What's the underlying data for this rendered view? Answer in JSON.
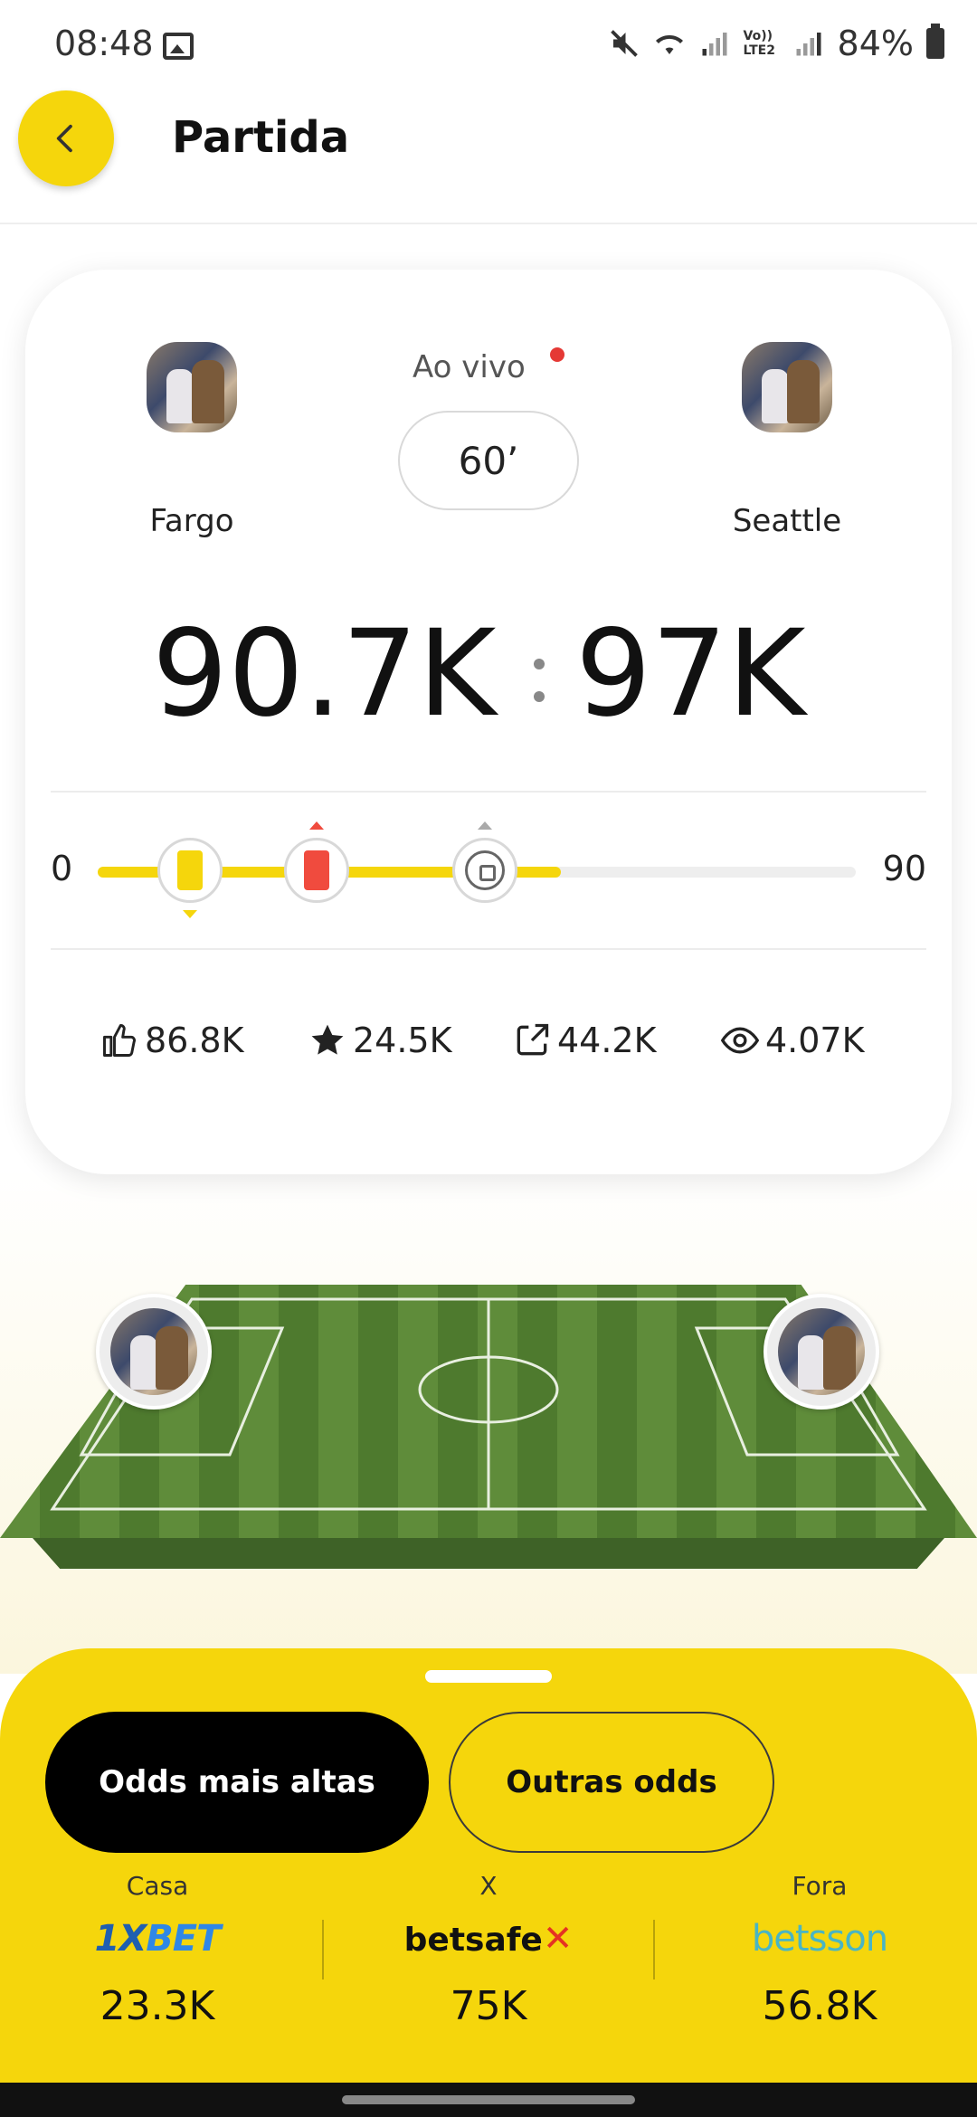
{
  "status_bar": {
    "time": "08:48",
    "battery": "84%",
    "icons": [
      "gallery-icon",
      "mute-icon",
      "wifi-icon",
      "signal-icon",
      "volte-icon",
      "battery-icon"
    ],
    "volte_label": "Vo)) LTE2"
  },
  "header": {
    "title": "Partida",
    "back_icon": "chevron-left-icon"
  },
  "match": {
    "home_team": "Fargo",
    "away_team": "Seattle",
    "live_label": "Ao vivo",
    "minute": "60’",
    "home_score": "90.7K",
    "away_score": "97K",
    "timeline": {
      "start": "0",
      "end": "90",
      "progress_minute": 55,
      "events": [
        {
          "type": "yellow-card",
          "minute": 11,
          "side": "home"
        },
        {
          "type": "red-card",
          "minute": 26,
          "side": "away"
        },
        {
          "type": "goal",
          "minute": 46,
          "side": "away"
        }
      ]
    },
    "stats": {
      "likes": "86.8K",
      "favorites": "24.5K",
      "shares": "44.2K",
      "views": "4.07K"
    }
  },
  "odds": {
    "tab_active": "Odds mais altas",
    "tab_inactive": "Outras odds",
    "columns": [
      {
        "label": "Casa",
        "bookmaker_a": "1X",
        "bookmaker_b": "BET",
        "value": "23.3K"
      },
      {
        "label": "X",
        "bookmaker_a": "betsafe",
        "bookmaker_b": "✕",
        "value": "75K"
      },
      {
        "label": "Fora",
        "bookmaker_a": "betsson",
        "bookmaker_b": "",
        "value": "56.8K"
      }
    ]
  },
  "colors": {
    "accent": "#f5d60c",
    "live_dot": "#e53935",
    "red_card": "#f04b3e",
    "field_green": "#5f8c3a"
  }
}
